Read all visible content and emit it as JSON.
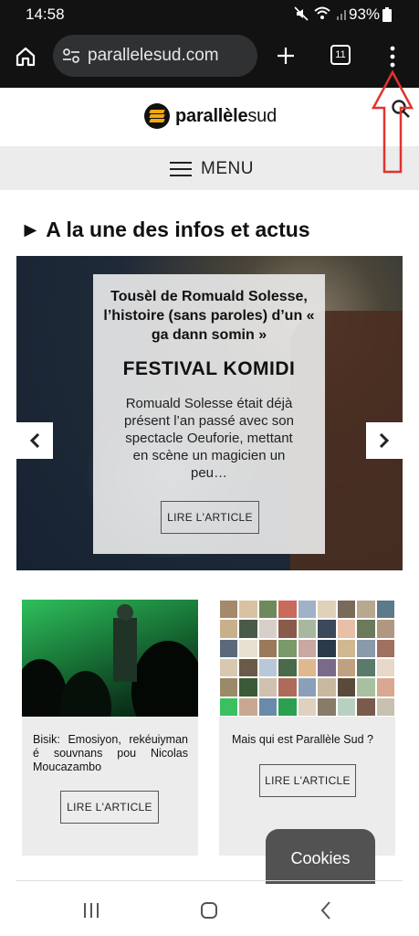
{
  "status_bar": {
    "time": "14:58",
    "battery": "93%",
    "icons": [
      "mute-icon",
      "wifi-icon",
      "signal-icon",
      "battery-icon"
    ]
  },
  "browser": {
    "url": "parallelesud.com",
    "tab_count": "11",
    "icons": [
      "home-icon",
      "site-settings-icon",
      "new-tab-icon",
      "tab-switcher-icon",
      "more-options-icon"
    ]
  },
  "site": {
    "logo_bold": "parallèle",
    "logo_light": "sud",
    "menu_label": "MENU"
  },
  "section": {
    "title": "► A la une des infos et actus"
  },
  "hero": {
    "headline": "Tousèl de Romuald Solesse, l’histoire (sans paroles) d’un « ga dann somin »",
    "kicker": "FESTIVAL KOMIDI",
    "excerpt": "Romuald Solesse était déjà présent l’an passé avec son spectacle Oeuforie, mettant en scène un magicien un peu…",
    "button": "LIRE L'ARTICLE"
  },
  "articles": [
    {
      "title": "Bisik: Emosiyon, rekéuiyman é souvnans pou Nicolas Moucazambo",
      "button": "LIRE L'ARTICLE"
    },
    {
      "title": "Mais qui est Parallèle Sud ?",
      "button": "LIRE L'ARTICLE"
    }
  ],
  "cookies": {
    "label": "Cookies"
  },
  "annotation": {
    "color": "#e0342c"
  },
  "colors": {
    "browser_bg": "#121212",
    "menu_bg": "#ececec",
    "logo_accent": "#f3a712"
  }
}
